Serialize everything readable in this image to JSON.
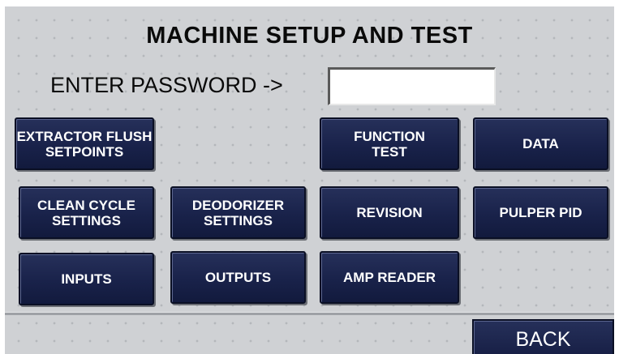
{
  "title": "MACHINE SETUP AND TEST",
  "password": {
    "label": "ENTER PASSWORD ->",
    "value": ""
  },
  "buttons": {
    "extractor_flush": "EXTRACTOR FLUSH\nSETPOINTS",
    "function_test": "FUNCTION\nTEST",
    "data": "DATA",
    "clean_cycle": "CLEAN CYCLE\nSETTINGS",
    "deodorizer": "DEODORIZER\nSETTINGS",
    "revision": "REVISION",
    "pulper_pid": "PULPER PID",
    "inputs": "INPUTS",
    "outputs": "OUTPUTS",
    "amp_reader": "AMP READER",
    "back": "BACK"
  },
  "colors": {
    "button_face": "#1c2550",
    "background": "#cfd1d4"
  }
}
